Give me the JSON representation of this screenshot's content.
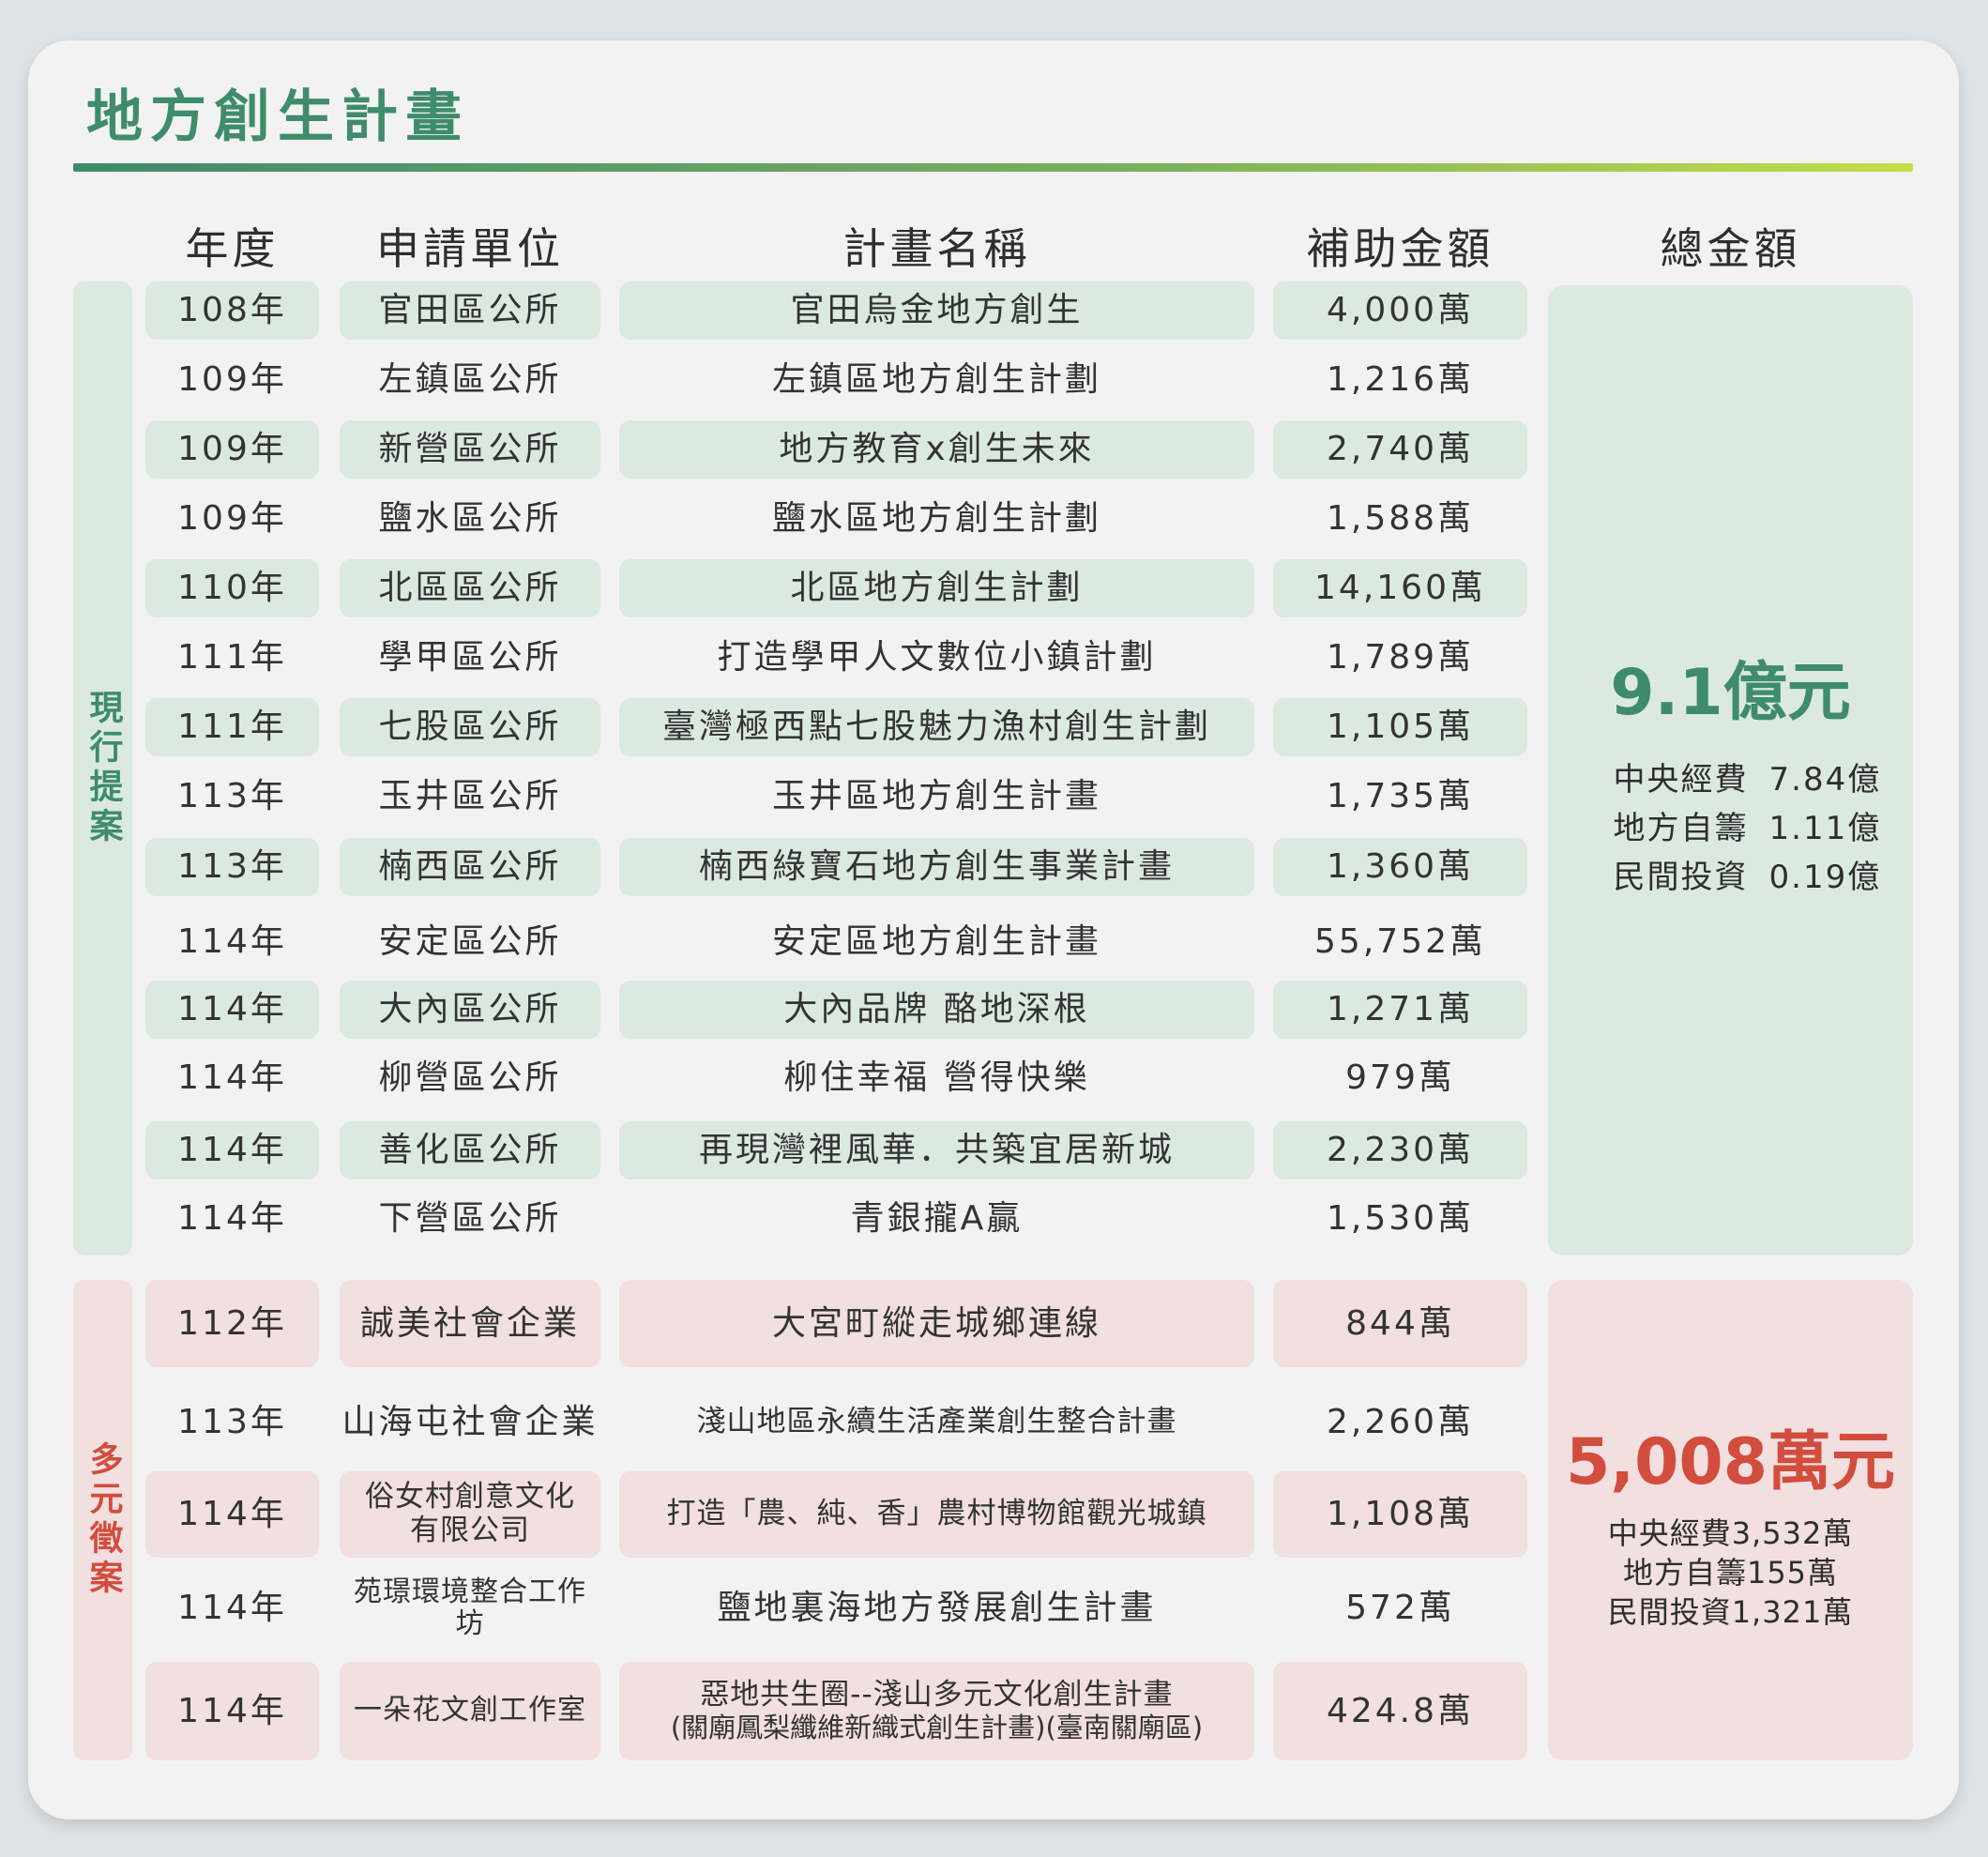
{
  "title": "地方創生計畫",
  "columns": {
    "year": "年度",
    "applicant": "申請單位",
    "plan": "計畫名稱",
    "subsidy": "補助金額",
    "total": "總金額"
  },
  "groups": {
    "current": "現行提案",
    "diverse": "多元徵案"
  },
  "current_rows": [
    {
      "year": "108年",
      "unit": "官田區公所",
      "plan": "官田烏金地方創生",
      "amount": "4,000萬"
    },
    {
      "year": "109年",
      "unit": "左鎮區公所",
      "plan": "左鎮區地方創生計劃",
      "amount": "1,216萬"
    },
    {
      "year": "109年",
      "unit": "新營區公所",
      "plan": "地方教育x創生未來",
      "amount": "2,740萬"
    },
    {
      "year": "109年",
      "unit": "鹽水區公所",
      "plan": "鹽水區地方創生計劃",
      "amount": "1,588萬"
    },
    {
      "year": "110年",
      "unit": "北區區公所",
      "plan": "北區地方創生計劃",
      "amount": "14,160萬"
    },
    {
      "year": "111年",
      "unit": "學甲區公所",
      "plan": "打造學甲人文數位小鎮計劃",
      "amount": "1,789萬"
    },
    {
      "year": "111年",
      "unit": "七股區公所",
      "plan": "臺灣極西點七股魅力漁村創生計劃",
      "amount": "1,105萬"
    },
    {
      "year": "113年",
      "unit": "玉井區公所",
      "plan": "玉井區地方創生計畫",
      "amount": "1,735萬"
    },
    {
      "year": "113年",
      "unit": "楠西區公所",
      "plan": "楠西綠寶石地方創生事業計畫",
      "amount": "1,360萬"
    },
    {
      "year": "114年",
      "unit": "安定區公所",
      "plan": "安定區地方創生計畫",
      "amount": "55,752萬"
    },
    {
      "year": "114年",
      "unit": "大內區公所",
      "plan": "大內品牌 酪地深根",
      "amount": "1,271萬"
    },
    {
      "year": "114年",
      "unit": "柳營區公所",
      "plan": "柳住幸福 營得快樂",
      "amount": "979萬"
    },
    {
      "year": "114年",
      "unit": "善化區公所",
      "plan": "再現灣裡風華．共築宜居新城",
      "amount": "2,230萬"
    },
    {
      "year": "114年",
      "unit": "下營區公所",
      "plan": "青銀攏A贏",
      "amount": "1,530萬"
    }
  ],
  "diverse_rows": [
    {
      "year": "112年",
      "unit": "誠美社會企業",
      "unit2": "",
      "plan": "大宮町縱走城鄉連線",
      "plan2": "",
      "amount": "844萬"
    },
    {
      "year": "113年",
      "unit": "山海屯社會企業",
      "unit2": "",
      "plan": "淺山地區永續生活產業創生整合計畫",
      "plan2": "",
      "amount": "2,260萬"
    },
    {
      "year": "114年",
      "unit": "俗女村創意文化",
      "unit2": "有限公司",
      "plan": "打造「農、純、香」農村博物館觀光城鎮",
      "plan2": "",
      "amount": "1,108萬"
    },
    {
      "year": "114年",
      "unit": "苑璟環境整合工作坊",
      "unit2": "",
      "plan": "鹽地裏海地方發展創生計畫",
      "plan2": "",
      "amount": "572萬"
    },
    {
      "year": "114年",
      "unit": "一朵花文創工作室",
      "unit2": "",
      "plan": "惡地共生圈--淺山多元文化創生計畫",
      "plan2": "(關廟鳳梨纖維新織式創生計畫)(臺南關廟區)",
      "amount": "424.8萬"
    }
  ],
  "current_total": {
    "amount": "9.1億元",
    "breakdown": [
      {
        "label": "中央經費",
        "value": "7.84億"
      },
      {
        "label": "地方自籌",
        "value": "1.11億"
      },
      {
        "label": "民間投資",
        "value": "0.19億"
      }
    ]
  },
  "diverse_total": {
    "amount": "5,008萬元",
    "breakdown": [
      "中央經費3,532萬",
      "地方自籌155萬",
      "民間投資1,321萬"
    ]
  },
  "colors": {
    "green_accent": "#3e8c6b",
    "green_fill": "#dbe9e1",
    "pink_accent": "#d24d3d",
    "pink_fill": "#f2dfdf"
  }
}
